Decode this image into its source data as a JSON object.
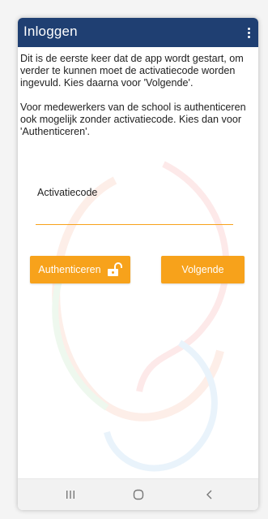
{
  "app_bar": {
    "title": "Inloggen",
    "color": "#1f3f72"
  },
  "intro": {
    "paragraph_1": "Dit is de eerste keer dat de app wordt gestart, om verder te kunnen moet de activatiecode worden ingevuld. Kies daarna voor 'Volgende'.",
    "paragraph_2": "Voor medewerkers van de school is authenticeren ook mogelijk zonder activatiecode. Kies dan voor 'Authenticeren'."
  },
  "activation": {
    "label": "Activatiecode",
    "value": "",
    "placeholder": ""
  },
  "buttons": {
    "authenticate_label": "Authenticeren",
    "next_label": "Volgende",
    "accent_color": "#f7a21b"
  },
  "icons": {
    "menu": "more-vert-icon",
    "lock": "unlock-icon",
    "recent": "recent-apps-icon",
    "home": "home-icon",
    "back": "back-icon"
  }
}
